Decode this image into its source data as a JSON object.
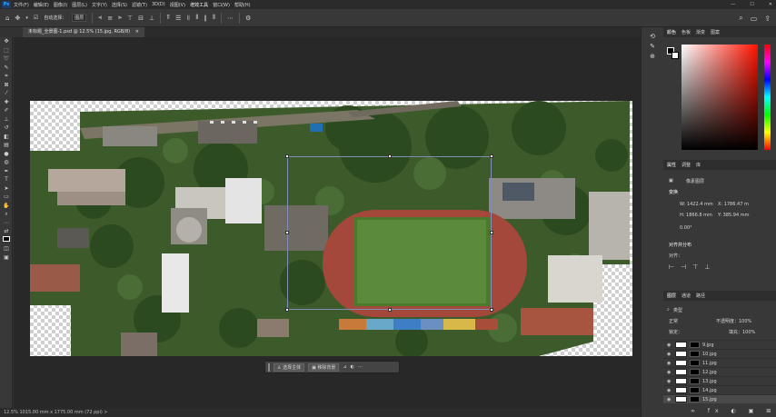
{
  "app": {
    "logo": "Ps"
  },
  "menu": [
    "文件(F)",
    "编辑(E)",
    "图像(I)",
    "图层(L)",
    "文字(Y)",
    "选择(S)",
    "滤镜(T)",
    "3D(D)",
    "视图(V)",
    "增效工具",
    "窗口(W)",
    "帮助(H)"
  ],
  "window_controls": [
    "—",
    "☐",
    "✕"
  ],
  "options": {
    "auto_select_label": "自动选择：",
    "auto_select_value": "图层"
  },
  "document": {
    "tab_title": "未标题_全景图-1.psd @ 12.5% (15.jpg, RGB/8)",
    "close": "×"
  },
  "context_bar": {
    "select_subject": "选择主体",
    "remove_bg": "移除背景",
    "more": "···"
  },
  "statusbar": {
    "text": "12.5%   1015.00 mm x 1775.00 mm (72 ppi)   >"
  },
  "panels": {
    "color_tabs": [
      "颜色",
      "色板",
      "渐变",
      "图案"
    ],
    "properties_tabs": [
      "属性",
      "调整",
      "库"
    ],
    "properties": {
      "kind": "像素图层",
      "transform_label": "变换",
      "w": "W: 1422.4 mm",
      "x": "X: 1786.47 m",
      "h": "H: 1866.8 mm",
      "y": "Y: 385.94 mm",
      "angle": "0.00°",
      "align_label": "对齐并分布",
      "align_sub": "对齐："
    },
    "layers_tabs": [
      "图层",
      "通道",
      "路径"
    ],
    "layers_filter": "类型",
    "blend_mode": "正常",
    "opacity": "不透明度：100%",
    "lock_label": "锁定：",
    "fill": "填充：100%",
    "layers": [
      "9.jpg",
      "10.jpg",
      "11.jpg",
      "12.jpg",
      "13.jpg",
      "14.jpg",
      "15.jpg"
    ]
  },
  "colors": {
    "accent": "#31a8ff",
    "canvas_bg": "#282828",
    "panel_bg": "#383838",
    "selection": "#7f8fb8"
  }
}
